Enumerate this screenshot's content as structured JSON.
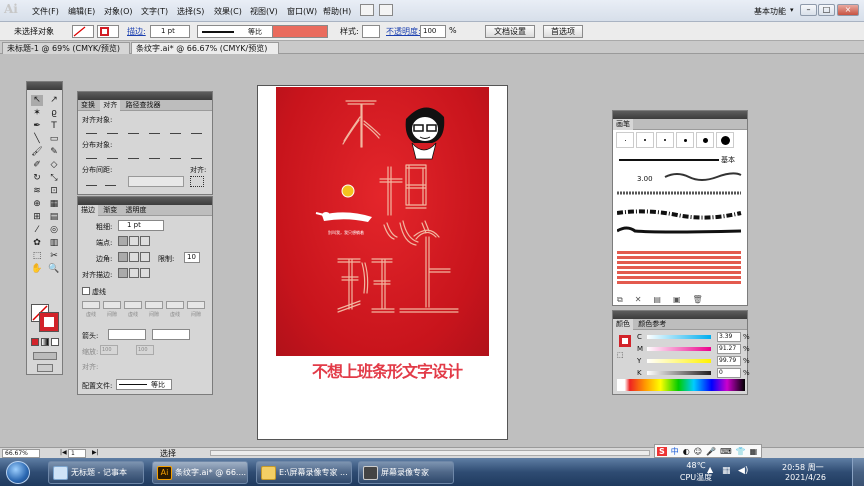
{
  "app": {
    "logo": "Ai",
    "menus": [
      "文件(F)",
      "编辑(E)",
      "对象(O)",
      "文字(T)",
      "选择(S)",
      "效果(C)",
      "视图(V)",
      "窗口(W)",
      "帮助(H)"
    ],
    "workspace": "基本功能",
    "window_controls": [
      "–",
      "□",
      "×"
    ]
  },
  "control_bar": {
    "selection": "未选择对象",
    "stroke_label": "描边:",
    "stroke_weight": "1 pt",
    "stroke_profile": "等比",
    "style_label": "样式:",
    "opacity_label": "不透明度:",
    "opacity_value": "100",
    "opacity_unit": "%",
    "doc_settings": "文档设置",
    "preferences": "首选项"
  },
  "tabs": [
    {
      "label": "未标题-1 @ 69% (CMYK/预览)",
      "close": "×"
    },
    {
      "label": "条纹字.ai* @ 66.67% (CMYK/预览)",
      "close": "×"
    }
  ],
  "align_panel": {
    "tabs": [
      "变换",
      "对齐",
      "路径查找器"
    ],
    "align_objects": "对齐对象:",
    "distribute_objects": "分布对象:",
    "distribute_spacing": "分布间距:",
    "align_to": "对齐:"
  },
  "stroke_panel": {
    "tabs": [
      "描边",
      "渐变",
      "透明度"
    ],
    "weight_label": "粗细:",
    "weight_value": "1 pt",
    "cap_label": "端点:",
    "corner_label": "边角:",
    "limit_label": "限制:",
    "limit_value": "10",
    "align_stroke": "对齐描边:",
    "dashed_line": "虚线",
    "dash_fields": [
      "虚线",
      "间隙",
      "虚线",
      "间隙",
      "虚线",
      "间隙"
    ],
    "arrow_label": "箭头:",
    "scale_label": "缩放:",
    "scale_value_1": "100",
    "scale_value_2": "100",
    "align_label": "对齐:",
    "profile_label": "配置文件:",
    "profile_value": "等比"
  },
  "brush_panel": {
    "tab": "画笔",
    "basic_label": "基本",
    "size_label": "3.00"
  },
  "color_panel": {
    "tabs": [
      "颜色",
      "颜色参考"
    ],
    "channels": [
      {
        "name": "C",
        "value": "3.39",
        "color": "#00aeef"
      },
      {
        "name": "M",
        "value": "91.27",
        "color": "#ec008c"
      },
      {
        "name": "Y",
        "value": "99.79",
        "color": "#fff200"
      },
      {
        "name": "K",
        "value": "0",
        "color": "#231f20"
      }
    ],
    "unit": "%"
  },
  "artwork": {
    "line1": "不想",
    "line2": "班上",
    "caption": "不想上班条形文字设计",
    "slogan": "别叫我，我只想躺着",
    "bg_color": "#d31a22",
    "stripe_color": "#f2b6a0"
  },
  "status": {
    "zoom": "66.67%",
    "page": "1",
    "tool": "选择"
  },
  "taskbar": {
    "items": [
      {
        "label": "无标题 - 记事本"
      },
      {
        "label": "条纹字.ai* @ 66...."
      },
      {
        "label": "E:\\屏幕录像专家 ..."
      },
      {
        "label": "屏幕录像专家"
      }
    ],
    "ime": "中",
    "temp": "48℃",
    "temp_label": "CPU温度",
    "time": "20:58 周一",
    "date": "2021/4/26"
  }
}
